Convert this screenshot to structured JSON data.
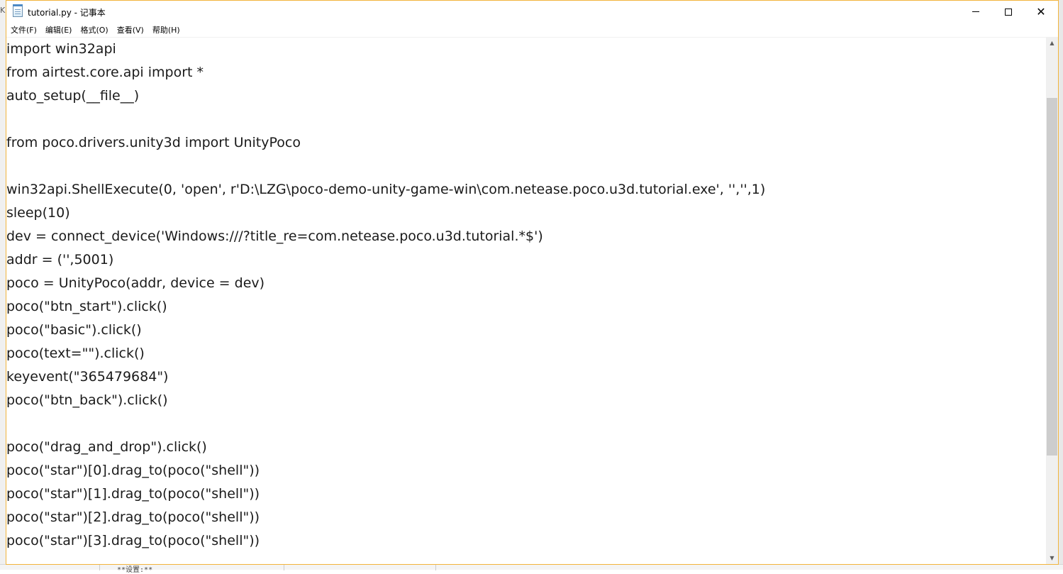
{
  "window": {
    "title": "tutorial.py - 记事本"
  },
  "menu": {
    "items": [
      "文件(F)",
      "编辑(E)",
      "格式(O)",
      "查看(V)",
      "帮助(H)"
    ]
  },
  "editor": {
    "lines": [
      "import win32api",
      "from airtest.core.api import *",
      "auto_setup(__file__)",
      "",
      "from poco.drivers.unity3d import UnityPoco",
      "",
      "win32api.ShellExecute(0, 'open', r'D:\\LZG\\poco-demo-unity-game-win\\com.netease.poco.u3d.tutorial.exe', '','',1)",
      "sleep(10)",
      "dev = connect_device('Windows:///?title_re=com.netease.poco.u3d.tutorial.*$')",
      "addr = ('',5001)",
      "poco = UnityPoco(addr, device = dev)",
      "poco(\"btn_start\").click()",
      "poco(\"basic\").click()",
      "poco(text=\"\").click()",
      "keyevent(\"365479684\")",
      "poco(\"btn_back\").click()",
      "",
      "poco(\"drag_and_drop\").click()",
      "poco(\"star\")[0].drag_to(poco(\"shell\"))",
      "poco(\"star\")[1].drag_to(poco(\"shell\"))",
      "poco(\"star\")[2].drag_to(poco(\"shell\"))",
      "poco(\"star\")[3].drag_to(poco(\"shell\"))"
    ]
  },
  "background": {
    "left_text": "Kr",
    "bottom_text": "**设置:**"
  },
  "colors": {
    "window_border": "#f2b43c",
    "scroll_thumb": "#cdcdcd"
  },
  "icons": {
    "app": "notepad-icon",
    "minimize": "minimize-icon",
    "maximize": "maximize-icon",
    "close": "close-icon"
  }
}
